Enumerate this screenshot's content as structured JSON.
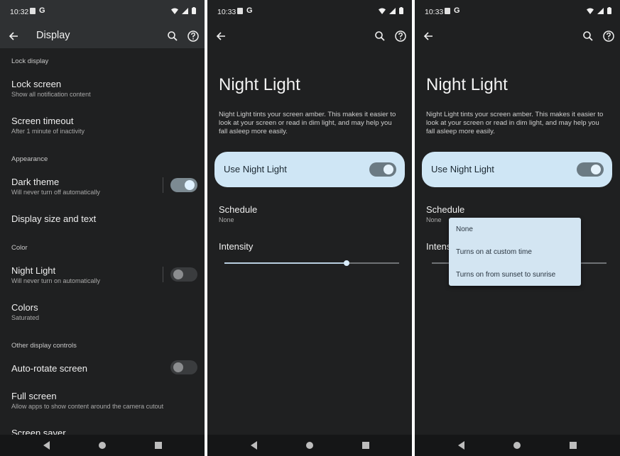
{
  "screen1": {
    "status_time": "10:32",
    "status_g": "G",
    "title": "Display",
    "sections": {
      "lock_display": "Lock display",
      "appearance": "Appearance",
      "color": "Color",
      "other": "Other display controls"
    },
    "items": {
      "lock_screen": {
        "title": "Lock screen",
        "subtitle": "Show all notification content"
      },
      "screen_timeout": {
        "title": "Screen timeout",
        "subtitle": "After 1 minute of inactivity"
      },
      "dark_theme": {
        "title": "Dark theme",
        "subtitle": "Will never turn off automatically",
        "toggle": "on"
      },
      "display_size": {
        "title": "Display size and text"
      },
      "night_light": {
        "title": "Night Light",
        "subtitle": "Will never turn on automatically",
        "toggle": "off"
      },
      "colors": {
        "title": "Colors",
        "subtitle": "Saturated"
      },
      "auto_rotate": {
        "title": "Auto-rotate screen",
        "toggle": "off"
      },
      "full_screen": {
        "title": "Full screen",
        "subtitle": "Allow apps to show content around the camera cutout"
      },
      "screen_saver": {
        "title": "Screen saver"
      }
    }
  },
  "screen2": {
    "status_time": "10:33",
    "status_g": "G",
    "heading": "Night Light",
    "description": "Night Light tints your screen amber. This makes it easier to look at your screen or read in dim light, and may help you fall asleep more easily.",
    "use_label": "Use Night Light",
    "use_toggle": "on",
    "schedule_title": "Schedule",
    "schedule_value": "None",
    "intensity_title": "Intensity",
    "intensity_level": 0.7
  },
  "screen3": {
    "status_time": "10:33",
    "status_g": "G",
    "heading": "Night Light",
    "description": "Night Light tints your screen amber. This makes it easier to look at your screen or read in dim light, and may help you fall asleep more easily.",
    "use_label": "Use Night Light",
    "use_toggle": "on",
    "schedule_title": "Schedule",
    "schedule_value": "None",
    "intensity_title": "Intensity",
    "dropdown_options": [
      "None",
      "Turns on at custom time",
      "Turns on from sunset to sunrise"
    ]
  },
  "icons": {
    "back": "arrow-left-icon",
    "search": "search-icon",
    "help": "help-circle-icon",
    "wifi": "wifi-icon",
    "signal": "signal-icon",
    "battery": "battery-icon"
  },
  "colors": {
    "background": "#1f2021",
    "toolbar": "#2f3133",
    "card": "#cfe6f5",
    "dropdown": "#d3e5f2"
  }
}
